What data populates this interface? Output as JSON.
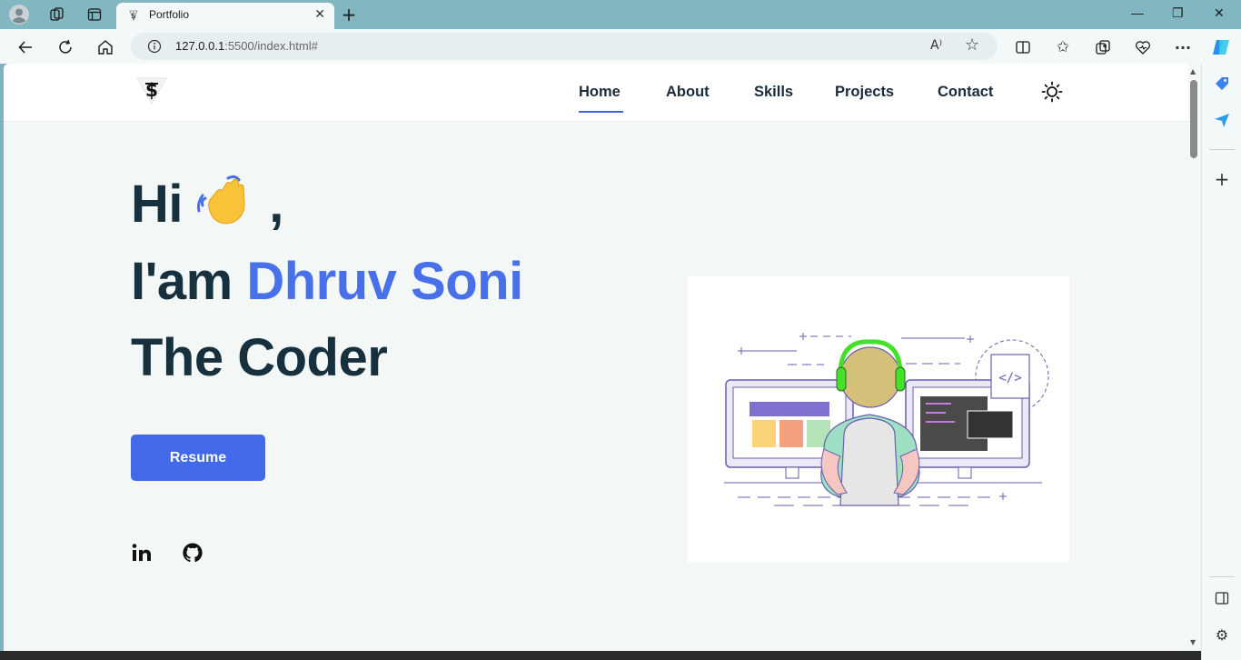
{
  "browser": {
    "tab_title": "Portfolio",
    "url_host": "127.0.0.1",
    "url_rest": ":5500/index.html#",
    "icons": [
      "profile-icon",
      "workspaces-icon",
      "tab-actions-icon",
      "favicon",
      "close-icon",
      "new-tab-icon",
      "minimize-icon",
      "restore-icon",
      "window-close-icon",
      "back-icon",
      "refresh-icon",
      "home-icon",
      "site-info-icon",
      "read-aloud-icon",
      "favorite-star-icon",
      "split-screen-icon",
      "favorites-icon",
      "collections-icon",
      "browser-essentials-icon",
      "more-icon",
      "copilot-icon"
    ]
  },
  "nav": {
    "items": [
      {
        "label": "Home",
        "active": true
      },
      {
        "label": "About"
      },
      {
        "label": "Skills"
      },
      {
        "label": "Projects"
      },
      {
        "label": "Contact"
      }
    ]
  },
  "hero": {
    "line1_prefix": "Hi",
    "line1_suffix": ",",
    "line2_prefix": "I'am",
    "name": "Dhruv Soni",
    "line3": "The Coder",
    "resume_label": "Resume"
  },
  "social": [
    "linkedin-icon",
    "github-icon"
  ],
  "colors": {
    "accent": "#4870e8",
    "heading": "#17303d",
    "page_bg": "#f3f8f6",
    "browser_frame": "#82b6c1"
  }
}
